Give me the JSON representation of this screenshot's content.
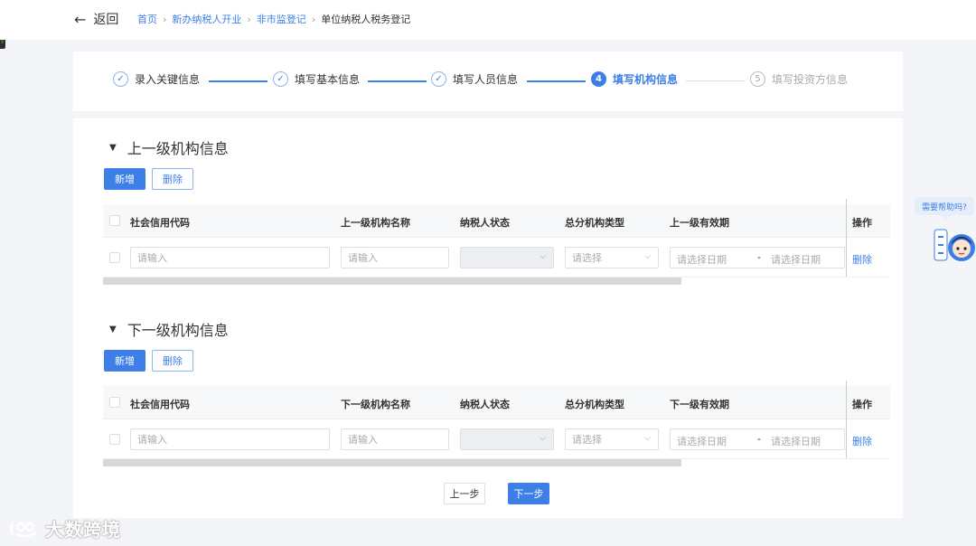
{
  "header": {
    "back_label": "返回",
    "breadcrumb": [
      "首页",
      "新办纳税人开业",
      "非市监登记",
      "单位纳税人税务登记"
    ],
    "separator": "›"
  },
  "steps": [
    {
      "index": "✓",
      "label": "录入关键信息",
      "state": "done"
    },
    {
      "index": "✓",
      "label": "填写基本信息",
      "state": "done"
    },
    {
      "index": "✓",
      "label": "填写人员信息",
      "state": "done"
    },
    {
      "index": "4",
      "label": "填写机构信息",
      "state": "active"
    },
    {
      "index": "5",
      "label": "填写投资方信息",
      "state": "pending"
    }
  ],
  "sections": [
    {
      "title": "上一级机构信息",
      "add_label": "新增",
      "delete_label": "删除",
      "columns": [
        "社会信用代码",
        "上一级机构名称",
        "纳税人状态",
        "总分机构类型",
        "上一级有效期",
        "操作"
      ],
      "row": {
        "credit_code_placeholder": "请输入",
        "org_name_placeholder": "请输入",
        "status_value": "",
        "type_placeholder": "请选择",
        "date_start_placeholder": "请选择日期",
        "date_sep": "-",
        "date_end_placeholder": "请选择日期",
        "action_label": "删除"
      }
    },
    {
      "title": "下一级机构信息",
      "add_label": "新增",
      "delete_label": "删除",
      "columns": [
        "社会信用代码",
        "下一级机构名称",
        "纳税人状态",
        "总分机构类型",
        "下一级有效期",
        "操作"
      ],
      "row": {
        "credit_code_placeholder": "请输入",
        "org_name_placeholder": "请输入",
        "status_value": "",
        "type_placeholder": "请选择",
        "date_start_placeholder": "请选择日期",
        "date_sep": "-",
        "date_end_placeholder": "请选择日期",
        "action_label": "删除"
      }
    }
  ],
  "footer": {
    "prev_label": "上一步",
    "next_label": "下一步"
  },
  "help": {
    "bubble_text": "需要帮助吗?"
  },
  "watermark": {
    "text": "大数跨境"
  },
  "colors": {
    "accent": "#3d7fe6",
    "page_bg": "#f3f5f8"
  }
}
